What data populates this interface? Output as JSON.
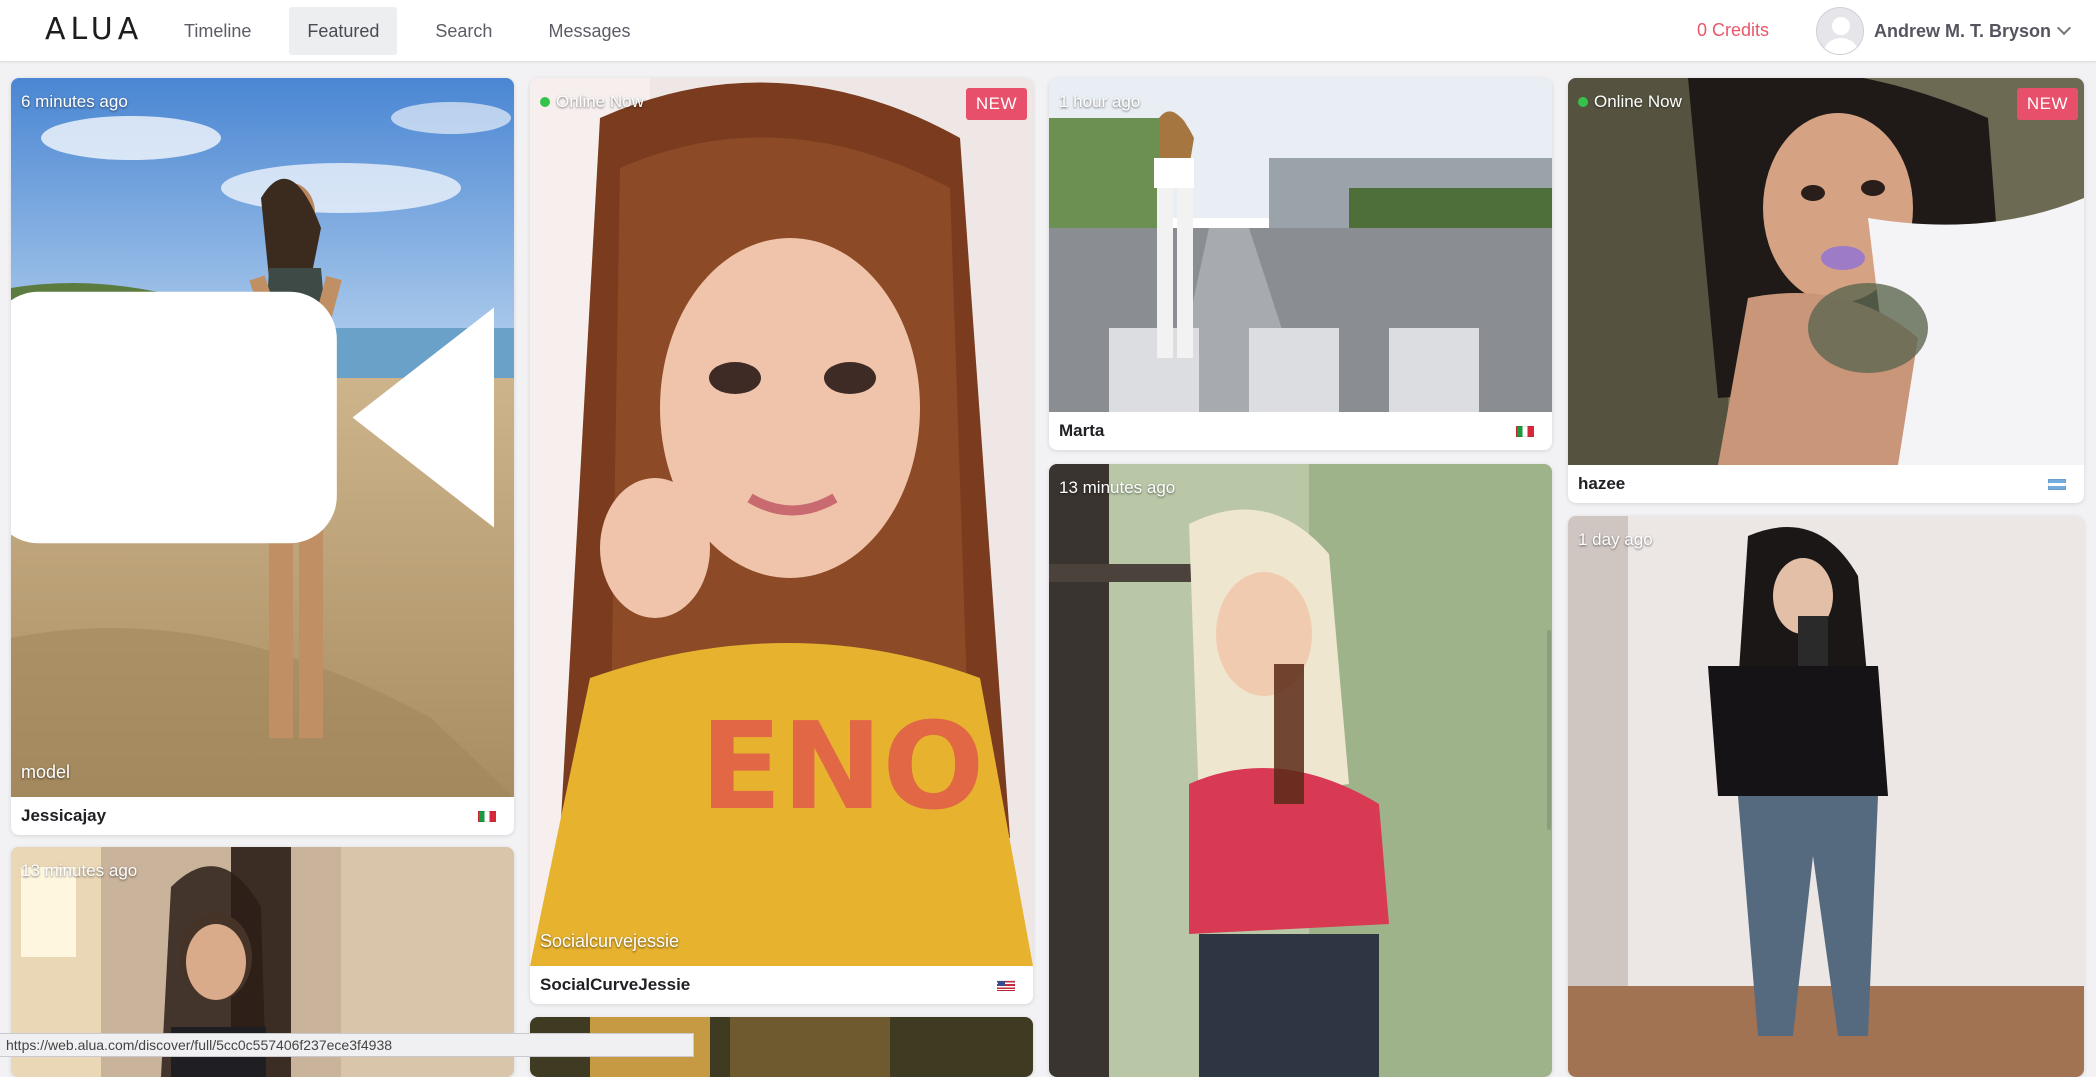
{
  "header": {
    "logo": "ALUA",
    "nav": [
      {
        "label": "Timeline",
        "active": false
      },
      {
        "label": "Featured",
        "active": true
      },
      {
        "label": "Search",
        "active": false
      },
      {
        "label": "Messages",
        "active": false
      }
    ],
    "credits": "0 Credits",
    "user_name": "Andrew M. T. Bryson",
    "avatar_icon": "default-user-avatar",
    "menu_icon": "chevron-down-icon"
  },
  "cards": {
    "jessicajay": {
      "status": "6 minutes ago",
      "caption": "model",
      "media_icon": "video-camera-icon",
      "name": "Jessicajay",
      "flag": "italy-flag"
    },
    "c1_second": {
      "status": "13 minutes ago"
    },
    "socialcurvejessie": {
      "status": "Online Now",
      "badge": "NEW",
      "caption": "Socialcurvejessie",
      "name": "SocialCurveJessie",
      "flag": "usa-flag"
    },
    "marta": {
      "status": "1 hour ago",
      "name": "Marta",
      "flag": "italy-flag"
    },
    "c3_second": {
      "status": "13 minutes ago"
    },
    "hazee": {
      "status": "Online Now",
      "badge": "NEW",
      "name": "hazee",
      "flag": "argentina-flag"
    },
    "c4_second": {
      "status": "1 day ago"
    }
  },
  "colors": {
    "accent": "#e84f6a",
    "credits": "#e8576a",
    "online": "#35c24b"
  },
  "status_url": "https://web.alua.com/discover/full/5cc0c557406f237ece3f4938"
}
